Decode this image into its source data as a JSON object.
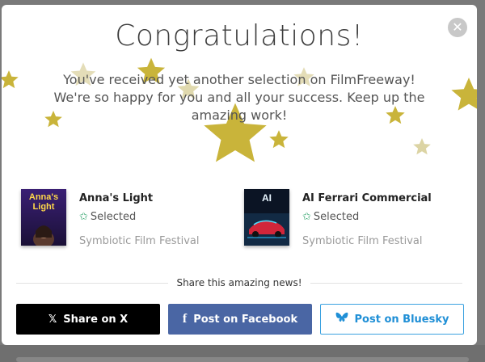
{
  "modal": {
    "title": "Congratulations!",
    "message": "You've received yet another selection on FilmFreeway! We're so happy for you and all your success. Keep up the amazing work!",
    "close_icon": "close-icon"
  },
  "selections": [
    {
      "poster_text": "Anna's Light",
      "title": "Anna's Light",
      "status": "Selected",
      "festival": "Symbiotic Film Festival"
    },
    {
      "poster_text": "AI",
      "title": "AI Ferrari Commercial",
      "status": "Selected",
      "festival": "Symbiotic Film Festival"
    }
  ],
  "share": {
    "label": "Share this amazing news!",
    "buttons": [
      {
        "label": "Share on X",
        "icon": "x-logo-icon",
        "color": "#000000"
      },
      {
        "label": "Post on Facebook",
        "icon": "facebook-logo-icon",
        "color": "#4a66a4"
      },
      {
        "label": "Post on Bluesky",
        "icon": "bluesky-logo-icon",
        "color": "#1f8fd6"
      }
    ]
  },
  "colors": {
    "star": "#c9b43a",
    "selected_icon": "#2fa36b"
  }
}
